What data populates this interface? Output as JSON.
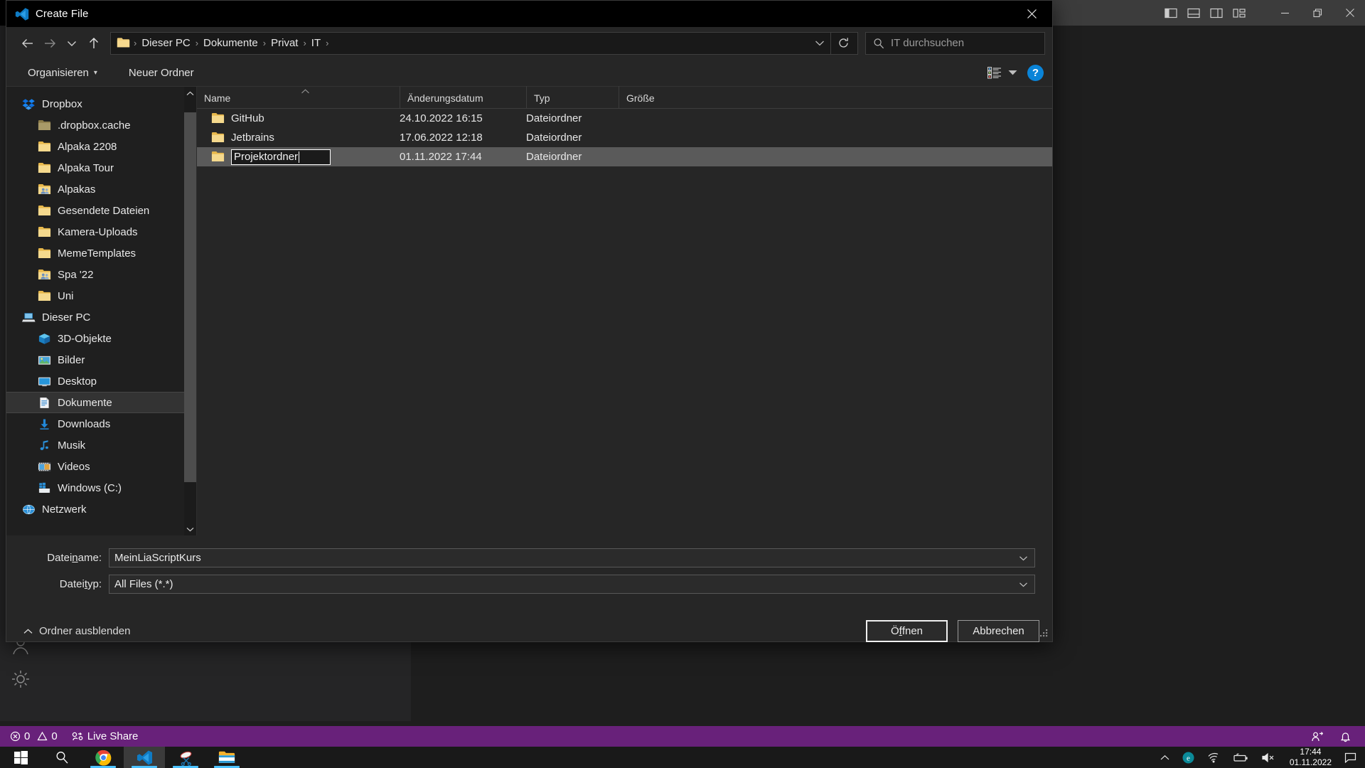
{
  "vscode": {
    "layout_icons": [
      "toggle-primary-sidebar-icon",
      "toggle-panel-icon",
      "toggle-secondary-sidebar-icon",
      "customize-layout-icon"
    ],
    "window_controls": [
      "minimize-button",
      "restore-button",
      "close-button"
    ],
    "statusbar": {
      "errors_icon": "error-circle-icon",
      "errors_count": "0",
      "warnings_icon": "warning-triangle-icon",
      "warnings_count": "0",
      "live_share_icon": "live-share-icon",
      "live_share_label": "Live Share",
      "accounts_icon": "accounts-person-icon",
      "bell_icon": "notification-bell-icon",
      "bg_color": "#68217a"
    },
    "activity_icons": [
      "account-icon",
      "settings-gear-icon"
    ]
  },
  "dialog": {
    "title": "Create File",
    "title_icon": "vscode-logo-icon",
    "close_icon": "close-icon",
    "nav": {
      "back_icon": "arrow-left-icon",
      "forward_icon": "arrow-right-icon",
      "recent_icon": "chevron-down-icon",
      "up_icon": "arrow-up-icon"
    },
    "address": {
      "folder_icon": "folder-icon",
      "crumbs": [
        "Dieser PC",
        "Dokumente",
        "Privat",
        "IT"
      ],
      "separator": "›",
      "dropdown_icon": "chevron-down-icon",
      "refresh_icon": "refresh-icon"
    },
    "search": {
      "icon": "search-icon",
      "placeholder": "IT durchsuchen",
      "value": ""
    },
    "toolbar": {
      "organize_label": "Organisieren",
      "organize_caret": "▾",
      "new_folder_label": "Neuer Ordner",
      "view_icon": "view-list-icon",
      "view_caret_icon": "chevron-down-icon",
      "help_icon": "help-icon",
      "help_label": "?"
    },
    "tree": {
      "scroll_up_icon": "chevron-up-icon",
      "scroll_down_icon": "chevron-down-icon",
      "items": [
        {
          "label": "Dropbox",
          "icon": "dropbox-icon",
          "level": 0,
          "selected": false
        },
        {
          "label": ".dropbox.cache",
          "icon": "folder-dim-icon",
          "level": 1,
          "selected": false
        },
        {
          "label": "Alpaka 2208",
          "icon": "folder-icon",
          "level": 1,
          "selected": false
        },
        {
          "label": "Alpaka Tour",
          "icon": "folder-icon",
          "level": 1,
          "selected": false
        },
        {
          "label": "Alpakas",
          "icon": "folder-shared-icon",
          "level": 1,
          "selected": false
        },
        {
          "label": "Gesendete Dateien",
          "icon": "folder-icon",
          "level": 1,
          "selected": false
        },
        {
          "label": "Kamera-Uploads",
          "icon": "folder-icon",
          "level": 1,
          "selected": false
        },
        {
          "label": "MemeTemplates",
          "icon": "folder-icon",
          "level": 1,
          "selected": false
        },
        {
          "label": "Spa '22",
          "icon": "folder-shared-icon",
          "level": 1,
          "selected": false
        },
        {
          "label": "Uni",
          "icon": "folder-icon",
          "level": 1,
          "selected": false
        },
        {
          "label": "Dieser PC",
          "icon": "this-pc-icon",
          "level": 0,
          "selected": false
        },
        {
          "label": "3D-Objekte",
          "icon": "3d-objects-icon",
          "level": 1,
          "selected": false
        },
        {
          "label": "Bilder",
          "icon": "pictures-icon",
          "level": 1,
          "selected": false
        },
        {
          "label": "Desktop",
          "icon": "desktop-icon",
          "level": 1,
          "selected": false
        },
        {
          "label": "Dokumente",
          "icon": "documents-icon",
          "level": 1,
          "selected": true
        },
        {
          "label": "Downloads",
          "icon": "downloads-icon",
          "level": 1,
          "selected": false
        },
        {
          "label": "Musik",
          "icon": "music-icon",
          "level": 1,
          "selected": false
        },
        {
          "label": "Videos",
          "icon": "videos-icon",
          "level": 1,
          "selected": false
        },
        {
          "label": "Windows (C:)",
          "icon": "drive-icon",
          "level": 1,
          "selected": false
        },
        {
          "label": "Netzwerk",
          "icon": "network-icon",
          "level": 0,
          "selected": false
        }
      ]
    },
    "filelist": {
      "columns": [
        "Name",
        "Änderungsdatum",
        "Typ",
        "Größe"
      ],
      "sort_column": "Name",
      "sort_caret": "˄",
      "rows": [
        {
          "name": "GitHub",
          "icon": "folder-icon",
          "date": "24.10.2022 16:15",
          "type": "Dateiordner",
          "size": "",
          "selected": false,
          "editing": false
        },
        {
          "name": "Jetbrains",
          "icon": "folder-icon",
          "date": "17.06.2022 12:18",
          "type": "Dateiordner",
          "size": "",
          "selected": false,
          "editing": false
        },
        {
          "name": "Projektordner",
          "icon": "folder-icon",
          "date": "01.11.2022 17:44",
          "type": "Dateiordner",
          "size": "",
          "selected": true,
          "editing": true
        }
      ]
    },
    "form": {
      "filename_label_pre": "Datei",
      "filename_label_mnemonic": "n",
      "filename_label_post": "ame:",
      "filename_value": "MeinLiaScriptKurs",
      "filetype_label_pre": "Datei",
      "filetype_label_mnemonic": "t",
      "filetype_label_post": "yp:",
      "filetype_value": "All Files (*.*)",
      "dropdown_caret": "⌄"
    },
    "footer": {
      "hide_folders_icon": "chevron-up-icon",
      "hide_folders_label": "Ordner ausblenden",
      "open_label_pre": "Ö",
      "open_label_mnemonic": "f",
      "open_label_post": "fnen",
      "open_label_full": "Öffnen",
      "cancel_label": "Abbrechen",
      "resize_grip_icon": "resize-grip-icon"
    }
  },
  "taskbar": {
    "start_icon": "windows-start-icon",
    "search_icon": "search-icon",
    "apps": [
      {
        "icon": "chrome-icon",
        "name": "google-chrome",
        "active": false,
        "running": true
      },
      {
        "icon": "vscode-icon",
        "name": "visual-studio-code",
        "active": true,
        "running": true
      },
      {
        "icon": "snipping-tool-icon",
        "name": "snipping-tool",
        "active": false,
        "running": true
      },
      {
        "icon": "file-explorer-icon",
        "name": "file-explorer",
        "active": false,
        "running": true
      }
    ],
    "tray": {
      "overflow_icon": "chevron-up-icon",
      "items": [
        "edge-icon",
        "wifi-icon",
        "battery-icon",
        "volume-muted-icon"
      ],
      "time": "17:44",
      "date": "01.11.2022",
      "action_center_icon": "action-center-icon"
    }
  }
}
